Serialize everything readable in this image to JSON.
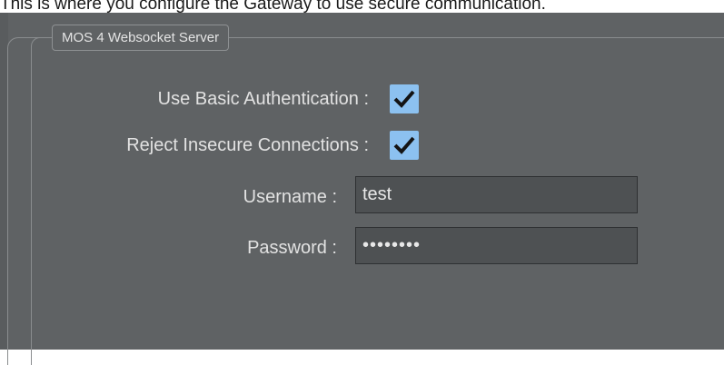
{
  "caption": "This is where you configure the Gateway to use secure communication.",
  "group": {
    "title": "MOS 4 Websocket Server"
  },
  "basic_auth": {
    "label": "Use Basic Authentication :",
    "checked": true
  },
  "reject_insecure": {
    "label": "Reject Insecure Connections :",
    "checked": true
  },
  "username": {
    "label": "Username :",
    "value": "test"
  },
  "password": {
    "label": "Password :",
    "value": "••••••••"
  },
  "colors": {
    "panel_bg": "#5f6264",
    "checkbox_fill": "#8cc1f0",
    "field_bg": "#4e5153",
    "text": "#e2e2e2"
  }
}
